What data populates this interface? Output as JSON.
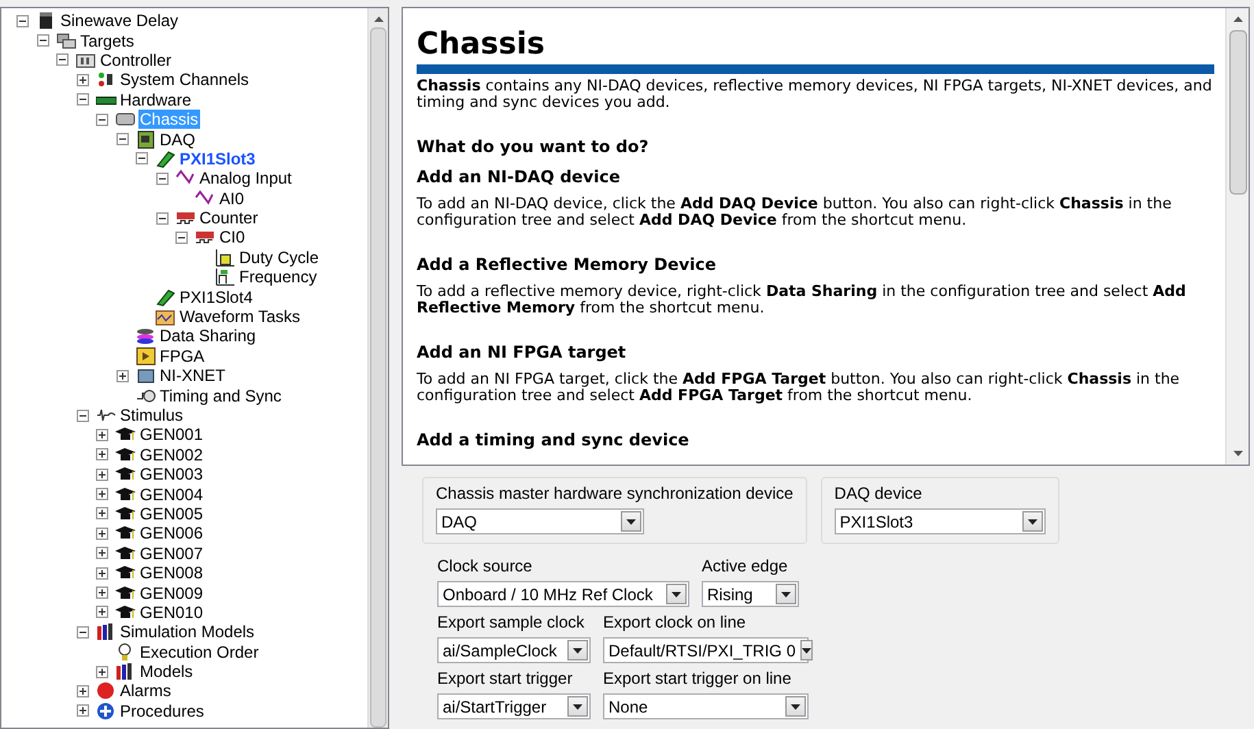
{
  "tree": [
    {
      "label": "Sinewave Delay",
      "kind": "project",
      "expanded": true,
      "selected": false,
      "active": false,
      "children": [
        {
          "label": "Targets",
          "kind": "targets",
          "expanded": true,
          "selected": false,
          "active": false,
          "children": [
            {
              "label": "Controller",
              "kind": "controller",
              "expanded": true,
              "selected": false,
              "active": false,
              "children": [
                {
                  "label": "System Channels",
                  "kind": "channels",
                  "expanded": false,
                  "selected": false,
                  "active": false
                },
                {
                  "label": "Hardware",
                  "kind": "hardware",
                  "expanded": true,
                  "selected": false,
                  "active": false,
                  "children": [
                    {
                      "label": "Chassis",
                      "kind": "chassis",
                      "expanded": true,
                      "selected": true,
                      "active": false,
                      "children": [
                        {
                          "label": "DAQ",
                          "kind": "daq",
                          "expanded": true,
                          "selected": false,
                          "active": false,
                          "children": [
                            {
                              "label": "PXI1Slot3",
                              "kind": "card",
                              "expanded": true,
                              "selected": false,
                              "active": true,
                              "children": [
                                {
                                  "label": "Analog Input",
                                  "kind": "analog",
                                  "expanded": true,
                                  "selected": false,
                                  "active": false,
                                  "children": [
                                    {
                                      "label": "AI0",
                                      "kind": "analog",
                                      "selected": false,
                                      "active": false
                                    }
                                  ]
                                },
                                {
                                  "label": "Counter",
                                  "kind": "counter",
                                  "expanded": true,
                                  "selected": false,
                                  "active": false,
                                  "children": [
                                    {
                                      "label": "CI0",
                                      "kind": "counter",
                                      "expanded": true,
                                      "selected": false,
                                      "active": false,
                                      "children": [
                                        {
                                          "label": "Duty Cycle",
                                          "kind": "duty",
                                          "selected": false,
                                          "active": false
                                        },
                                        {
                                          "label": "Frequency",
                                          "kind": "frequency",
                                          "selected": false,
                                          "active": false
                                        }
                                      ]
                                    }
                                  ]
                                }
                              ]
                            },
                            {
                              "label": "PXI1Slot4",
                              "kind": "card",
                              "selected": false,
                              "active": false
                            },
                            {
                              "label": "Waveform Tasks",
                              "kind": "waveform",
                              "selected": false,
                              "active": false
                            }
                          ]
                        },
                        {
                          "label": "Data Sharing",
                          "kind": "sharing",
                          "selected": false,
                          "active": false
                        },
                        {
                          "label": "FPGA",
                          "kind": "fpga",
                          "selected": false,
                          "active": false
                        },
                        {
                          "label": "NI-XNET",
                          "kind": "xnet",
                          "expanded": false,
                          "selected": false,
                          "active": false
                        },
                        {
                          "label": "Timing and Sync",
                          "kind": "timing",
                          "selected": false,
                          "active": false
                        }
                      ]
                    }
                  ]
                },
                {
                  "label": "Stimulus",
                  "kind": "stimulus",
                  "expanded": true,
                  "selected": false,
                  "active": false,
                  "children": [
                    {
                      "label": "GEN001",
                      "kind": "generator",
                      "expanded": false,
                      "selected": false,
                      "active": false
                    },
                    {
                      "label": "GEN002",
                      "kind": "generator",
                      "expanded": false,
                      "selected": false,
                      "active": false
                    },
                    {
                      "label": "GEN003",
                      "kind": "generator",
                      "expanded": false,
                      "selected": false,
                      "active": false
                    },
                    {
                      "label": "GEN004",
                      "kind": "generator",
                      "expanded": false,
                      "selected": false,
                      "active": false
                    },
                    {
                      "label": "GEN005",
                      "kind": "generator",
                      "expanded": false,
                      "selected": false,
                      "active": false
                    },
                    {
                      "label": "GEN006",
                      "kind": "generator",
                      "expanded": false,
                      "selected": false,
                      "active": false
                    },
                    {
                      "label": "GEN007",
                      "kind": "generator",
                      "expanded": false,
                      "selected": false,
                      "active": false
                    },
                    {
                      "label": "GEN008",
                      "kind": "generator",
                      "expanded": false,
                      "selected": false,
                      "active": false
                    },
                    {
                      "label": "GEN009",
                      "kind": "generator",
                      "expanded": false,
                      "selected": false,
                      "active": false
                    },
                    {
                      "label": "GEN010",
                      "kind": "generator",
                      "expanded": false,
                      "selected": false,
                      "active": false
                    }
                  ]
                },
                {
                  "label": "Simulation Models",
                  "kind": "models",
                  "expanded": true,
                  "selected": false,
                  "active": false,
                  "children": [
                    {
                      "label": "Execution Order",
                      "kind": "order",
                      "selected": false,
                      "active": false
                    },
                    {
                      "label": "Models",
                      "kind": "models",
                      "expanded": false,
                      "selected": false,
                      "active": false
                    }
                  ]
                },
                {
                  "label": "Alarms",
                  "kind": "alarms",
                  "expanded": false,
                  "selected": false,
                  "active": false
                },
                {
                  "label": "Procedures",
                  "kind": "procedures",
                  "expanded": false,
                  "selected": false,
                  "active": false
                }
              ]
            }
          ]
        }
      ]
    }
  ],
  "help": {
    "title": "Chassis",
    "blocks": [
      {
        "kind": "paragraph",
        "text": "**Chassis** contains any NI-DAQ devices, reflective memory devices, NI FPGA targets, NI-XNET devices, and timing and sync devices you add."
      },
      {
        "kind": "question",
        "text": "What do you want to do?"
      },
      {
        "kind": "heading",
        "text": "Add an NI-DAQ device"
      },
      {
        "kind": "paragraph",
        "text": "To add an NI-DAQ device, click the **Add DAQ Device** button. You also can right-click **Chassis** in the configuration tree and select **Add DAQ Device** from the shortcut menu."
      },
      {
        "kind": "heading",
        "text": "Add a Reflective Memory Device"
      },
      {
        "kind": "paragraph",
        "text": "To add a reflective memory device, right-click **Data Sharing** in the configuration tree and select **Add Reflective Memory** from the shortcut menu."
      },
      {
        "kind": "heading",
        "text": "Add an NI FPGA target"
      },
      {
        "kind": "paragraph",
        "text": "To add an NI FPGA target, click the **Add FPGA Target** button. You also can right-click **Chassis** in the configuration tree and select **Add FPGA Target** from the shortcut menu."
      },
      {
        "kind": "heading",
        "text": "Add a timing and sync device"
      }
    ]
  },
  "groups": [
    {
      "label": "Chassis master hardware synchronization device",
      "value": "DAQ"
    },
    {
      "label": "DAQ device",
      "value": "PXI1Slot3"
    }
  ],
  "settings": [
    [
      {
        "label": "Clock source",
        "value": "Onboard / 10 MHz Ref Clock"
      },
      {
        "label": "Active edge",
        "value": "Rising"
      }
    ],
    [
      {
        "label": "Export sample clock",
        "value": "ai/SampleClock"
      },
      {
        "label": "Export clock on line",
        "value": "Default/RTSI/PXI_TRIG 0"
      }
    ],
    [
      {
        "label": "Export start trigger",
        "value": "ai/StartTrigger"
      },
      {
        "label": "Export start trigger on line",
        "value": "None"
      }
    ]
  ]
}
